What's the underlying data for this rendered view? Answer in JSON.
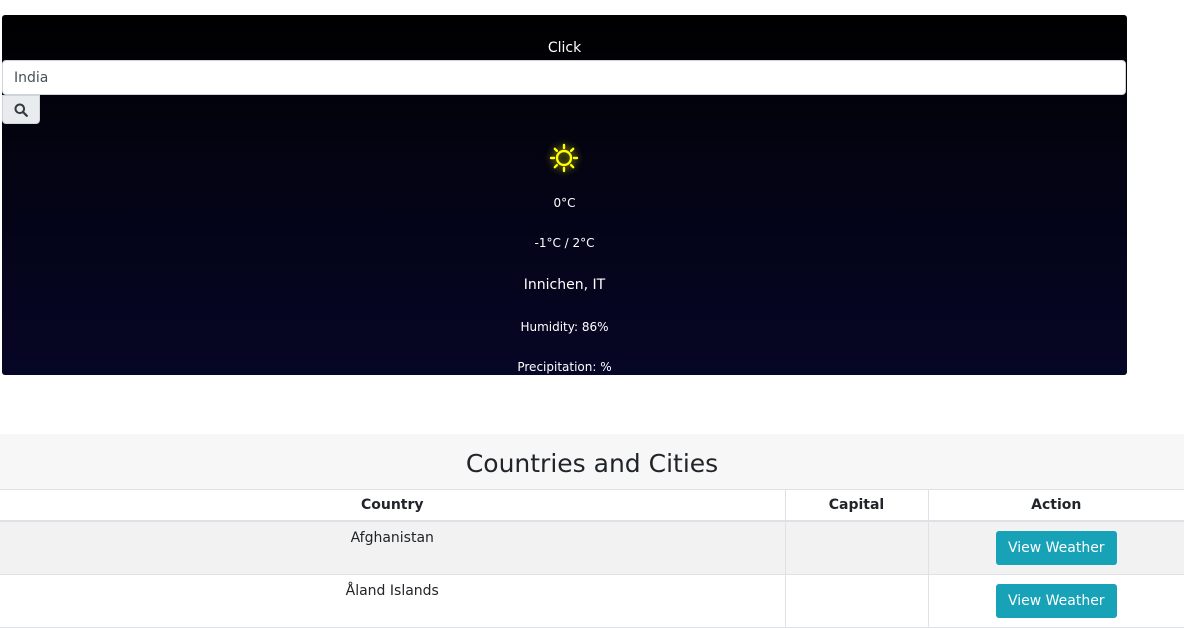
{
  "weather": {
    "click_label": "Click",
    "search": {
      "value": "India"
    },
    "icon": "sun-icon",
    "temperature": "0°C",
    "range": "-1°C / 2°C",
    "location": "Innichen, IT",
    "humidity": "Humidity: 86%",
    "precipitation": "Precipitation: %"
  },
  "section": {
    "title": "Countries and Cities"
  },
  "table": {
    "headers": [
      "Country",
      "Capital",
      "Action"
    ],
    "rows": [
      {
        "country": "Afghanistan",
        "capital": "",
        "action": "View Weather"
      },
      {
        "country": "Åland Islands",
        "capital": "",
        "action": "View Weather"
      }
    ]
  },
  "colors": {
    "accent": "#17a2b8",
    "sun": "#ffff00"
  }
}
